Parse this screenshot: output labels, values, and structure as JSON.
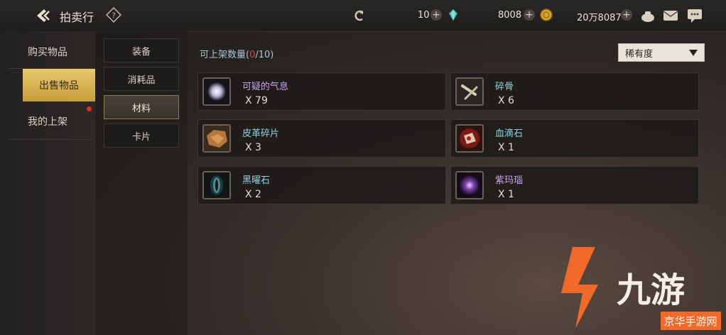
{
  "header": {
    "title": "拍卖行",
    "currencies": [
      {
        "icon": "diamond-icon",
        "value": "10"
      },
      {
        "icon": "gold-coin-icon",
        "value": "8008"
      },
      {
        "icon": "money-bag-icon",
        "value": "20万8087"
      }
    ]
  },
  "left_nav": [
    {
      "label": "购买物品",
      "active": false
    },
    {
      "label": "出售物品",
      "active": true
    },
    {
      "label": "我的上架",
      "active": false,
      "badge": true
    }
  ],
  "sub_nav": [
    {
      "label": "装备",
      "active": false
    },
    {
      "label": "消耗品",
      "active": false
    },
    {
      "label": "材料",
      "active": true
    },
    {
      "label": "卡片",
      "active": false
    }
  ],
  "listing": {
    "count_label": "可上架数量(",
    "count_current": "0",
    "count_rest": "/10)",
    "sort_label": "稀有度"
  },
  "items": [
    {
      "name": "可疑的气息",
      "qty": "X 79",
      "name_color": "#c9a6e8",
      "icon": "mist-icon"
    },
    {
      "name": "碎骨",
      "qty": "X 6",
      "name_color": "#8fd3df",
      "icon": "bone-icon"
    },
    {
      "name": "皮革碎片",
      "qty": "X 3",
      "name_color": "#8fd3df",
      "icon": "leather-icon"
    },
    {
      "name": "血滴石",
      "qty": "X 1",
      "name_color": "#8fd3df",
      "icon": "blood-stone-icon"
    },
    {
      "name": "黑曜石",
      "qty": "X 2",
      "name_color": "#8fd3df",
      "icon": "obsidian-icon"
    },
    {
      "name": "紫玛瑙",
      "qty": "X 1",
      "name_color": "#c9a6e8",
      "icon": "purple-agate-icon"
    }
  ],
  "watermark": {
    "brand": "九游",
    "sub": "京华手游网"
  }
}
